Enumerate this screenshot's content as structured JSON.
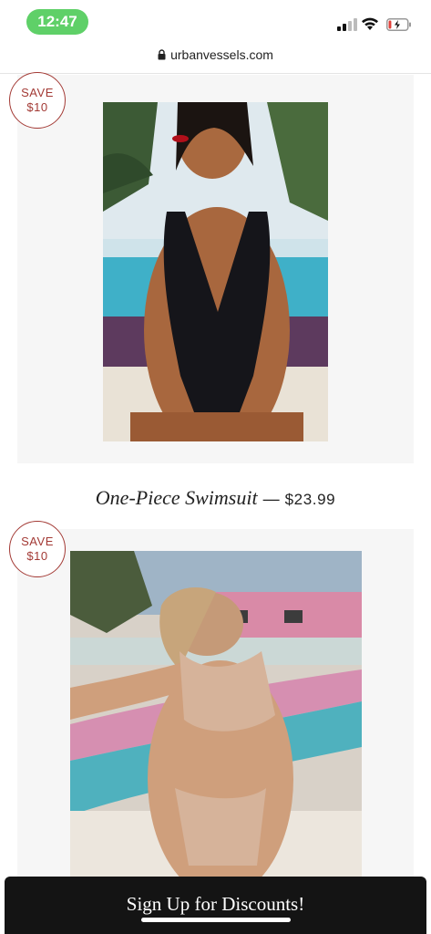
{
  "status_bar": {
    "time": "12:47",
    "signal_icon": "cellular-signal-icon",
    "wifi_icon": "wifi-icon",
    "battery_icon": "battery-charging-icon",
    "battery_level": 0.15
  },
  "browser": {
    "url": "urbanvessels.com",
    "lock_icon": "lock-icon"
  },
  "products": [
    {
      "badge_line1": "SAVE",
      "badge_line2": "$10",
      "name": "One-Piece Swimsuit",
      "separator": "—",
      "price": "$23.99",
      "image_alt": "Woman in black halter one-piece swimsuit by a pool"
    },
    {
      "badge_line1": "SAVE",
      "badge_line2": "$10",
      "image_alt": "Woman in nude tie-front bikini leaning on pool edge"
    }
  ],
  "signup": {
    "label": "Sign Up for Discounts!"
  },
  "colors": {
    "badge": "#a33a35",
    "card_bg": "#f6f6f6",
    "signup_bg": "#141414",
    "time_pill": "#5fd068"
  }
}
